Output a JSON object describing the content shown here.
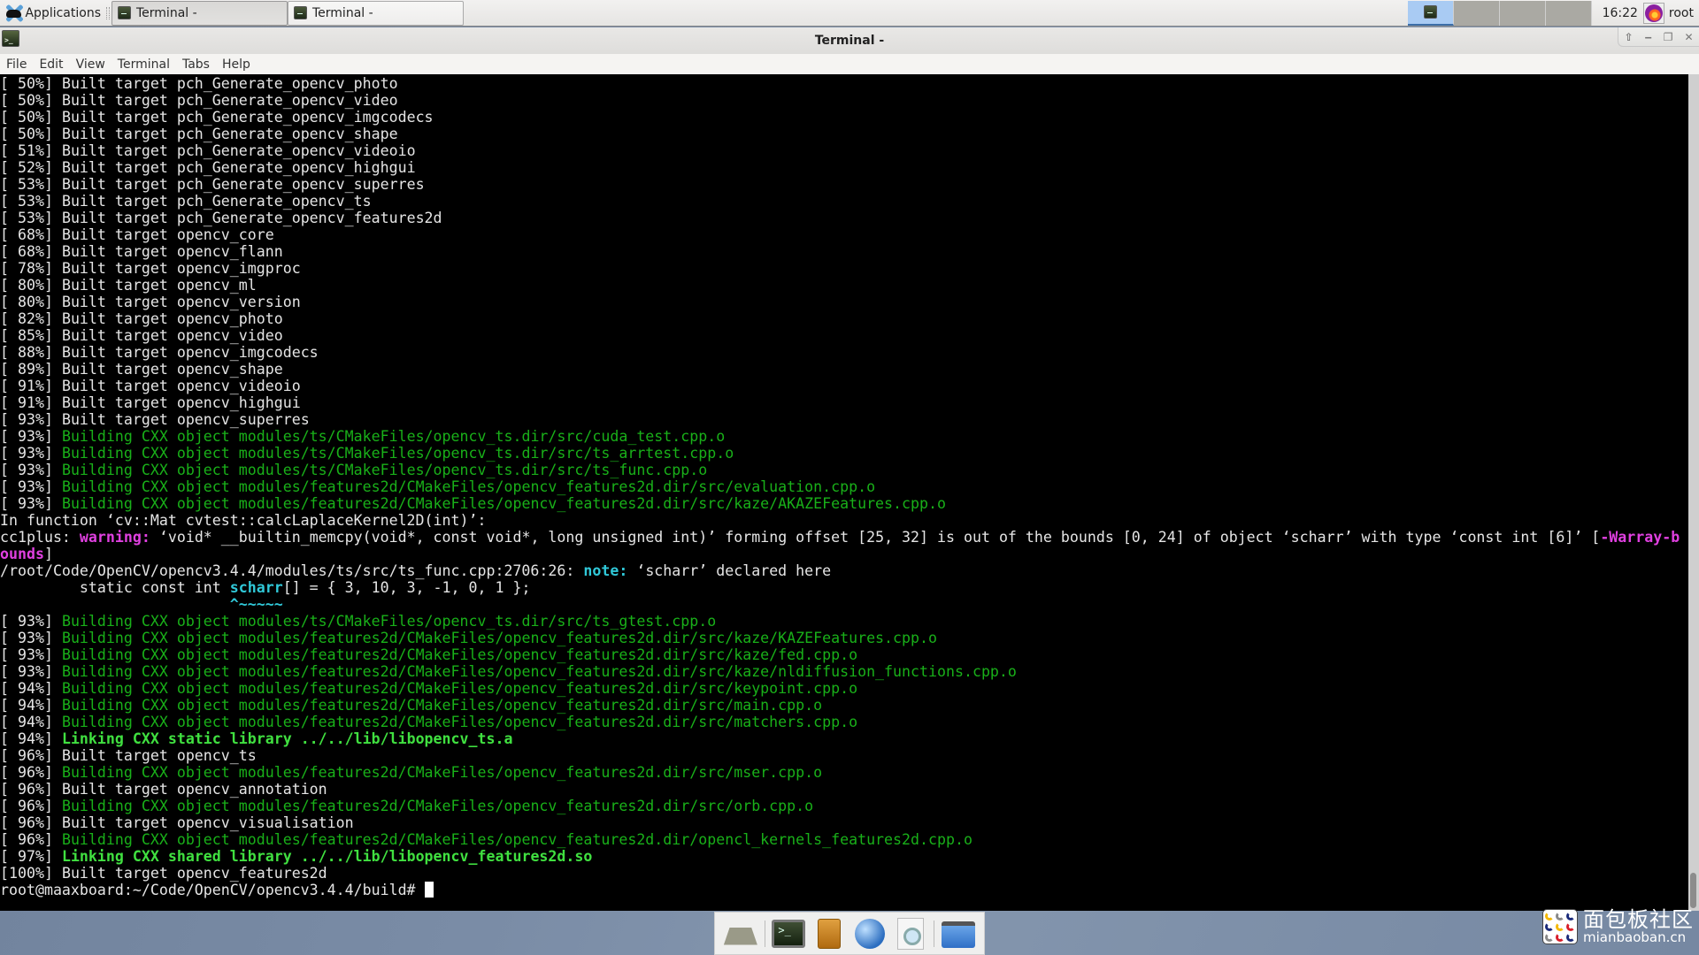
{
  "top_panel": {
    "applications_label": "Applications",
    "tasks": [
      {
        "label": "Terminal -",
        "active": true
      },
      {
        "label": "Terminal -",
        "active": false
      }
    ],
    "clock": "16:22",
    "user": "root"
  },
  "window": {
    "title": "Terminal -",
    "controls": {
      "shade": "⇧",
      "minimize": "‒",
      "maximize": "❐",
      "close": "✕"
    },
    "menu": [
      "File",
      "Edit",
      "View",
      "Terminal",
      "Tabs",
      "Help"
    ]
  },
  "terminal": {
    "lines": [
      {
        "type": "built",
        "pct": "[ 50%]",
        "text": "Built target pch_Generate_opencv_photo"
      },
      {
        "type": "built",
        "pct": "[ 50%]",
        "text": "Built target pch_Generate_opencv_video"
      },
      {
        "type": "built",
        "pct": "[ 50%]",
        "text": "Built target pch_Generate_opencv_imgcodecs"
      },
      {
        "type": "built",
        "pct": "[ 50%]",
        "text": "Built target pch_Generate_opencv_shape"
      },
      {
        "type": "built",
        "pct": "[ 51%]",
        "text": "Built target pch_Generate_opencv_videoio"
      },
      {
        "type": "built",
        "pct": "[ 52%]",
        "text": "Built target pch_Generate_opencv_highgui"
      },
      {
        "type": "built",
        "pct": "[ 53%]",
        "text": "Built target pch_Generate_opencv_superres"
      },
      {
        "type": "built",
        "pct": "[ 53%]",
        "text": "Built target pch_Generate_opencv_ts"
      },
      {
        "type": "built",
        "pct": "[ 53%]",
        "text": "Built target pch_Generate_opencv_features2d"
      },
      {
        "type": "built",
        "pct": "[ 68%]",
        "text": "Built target opencv_core"
      },
      {
        "type": "built",
        "pct": "[ 68%]",
        "text": "Built target opencv_flann"
      },
      {
        "type": "built",
        "pct": "[ 78%]",
        "text": "Built target opencv_imgproc"
      },
      {
        "type": "built",
        "pct": "[ 80%]",
        "text": "Built target opencv_ml"
      },
      {
        "type": "built",
        "pct": "[ 80%]",
        "text": "Built target opencv_version"
      },
      {
        "type": "built",
        "pct": "[ 82%]",
        "text": "Built target opencv_photo"
      },
      {
        "type": "built",
        "pct": "[ 85%]",
        "text": "Built target opencv_video"
      },
      {
        "type": "built",
        "pct": "[ 88%]",
        "text": "Built target opencv_imgcodecs"
      },
      {
        "type": "built",
        "pct": "[ 89%]",
        "text": "Built target opencv_shape"
      },
      {
        "type": "built",
        "pct": "[ 91%]",
        "text": "Built target opencv_videoio"
      },
      {
        "type": "built",
        "pct": "[ 91%]",
        "text": "Built target opencv_highgui"
      },
      {
        "type": "built",
        "pct": "[ 93%]",
        "text": "Built target opencv_superres"
      },
      {
        "type": "building",
        "pct": "[ 93%]",
        "text": "Building CXX object modules/ts/CMakeFiles/opencv_ts.dir/src/cuda_test.cpp.o"
      },
      {
        "type": "building",
        "pct": "[ 93%]",
        "text": "Building CXX object modules/ts/CMakeFiles/opencv_ts.dir/src/ts_arrtest.cpp.o"
      },
      {
        "type": "building",
        "pct": "[ 93%]",
        "text": "Building CXX object modules/ts/CMakeFiles/opencv_ts.dir/src/ts_func.cpp.o"
      },
      {
        "type": "building",
        "pct": "[ 93%]",
        "text": "Building CXX object modules/features2d/CMakeFiles/opencv_features2d.dir/src/evaluation.cpp.o"
      },
      {
        "type": "building",
        "pct": "[ 93%]",
        "text": "Building CXX object modules/features2d/CMakeFiles/opencv_features2d.dir/src/kaze/AKAZEFeatures.cpp.o"
      },
      {
        "type": "rich",
        "segments": [
          {
            "s": "plain",
            "t": "In function ‘"
          },
          {
            "s": "bold",
            "t": "cv::Mat cvtest::calcLaplaceKernel2D(int)"
          },
          {
            "s": "plain",
            "t": "’:"
          }
        ]
      },
      {
        "type": "rich",
        "segments": [
          {
            "s": "bold",
            "t": "cc1plus: "
          },
          {
            "s": "mag",
            "t": "warning: "
          },
          {
            "s": "plain",
            "t": "‘"
          },
          {
            "s": "bold",
            "t": "void* __builtin_memcpy(void*, const void*, long unsigned int)"
          },
          {
            "s": "plain",
            "t": "’ forming offset [25, 32] is out of the bounds [0, 24] of object ‘"
          },
          {
            "s": "bold",
            "t": "scharr"
          },
          {
            "s": "plain",
            "t": "’ with type ‘"
          },
          {
            "s": "bold",
            "t": "const int [6]"
          },
          {
            "s": "plain",
            "t": "’ ["
          },
          {
            "s": "mag",
            "t": "-Warray-b"
          }
        ]
      },
      {
        "type": "rich",
        "segments": [
          {
            "s": "mag",
            "t": "ounds"
          },
          {
            "s": "plain",
            "t": "]"
          }
        ]
      },
      {
        "type": "rich",
        "segments": [
          {
            "s": "bold",
            "t": "/root/Code/OpenCV/opencv3.4.4/modules/ts/src/ts_func.cpp:2706:26: "
          },
          {
            "s": "cy",
            "t": "note: "
          },
          {
            "s": "plain",
            "t": "‘"
          },
          {
            "s": "bold",
            "t": "scharr"
          },
          {
            "s": "plain",
            "t": "’ declared here"
          }
        ]
      },
      {
        "type": "rich",
        "segments": [
          {
            "s": "plain",
            "t": "         static const int "
          },
          {
            "s": "cy",
            "t": "scharr"
          },
          {
            "s": "plain",
            "t": "[] = { 3, 10, 3, -1, 0, 1 };"
          }
        ]
      },
      {
        "type": "rich",
        "segments": [
          {
            "s": "plain",
            "t": "                          "
          },
          {
            "s": "cy",
            "t": "^~~~~~"
          }
        ]
      },
      {
        "type": "building",
        "pct": "[ 93%]",
        "text": "Building CXX object modules/ts/CMakeFiles/opencv_ts.dir/src/ts_gtest.cpp.o"
      },
      {
        "type": "building",
        "pct": "[ 93%]",
        "text": "Building CXX object modules/features2d/CMakeFiles/opencv_features2d.dir/src/kaze/KAZEFeatures.cpp.o"
      },
      {
        "type": "building",
        "pct": "[ 93%]",
        "text": "Building CXX object modules/features2d/CMakeFiles/opencv_features2d.dir/src/kaze/fed.cpp.o"
      },
      {
        "type": "building",
        "pct": "[ 93%]",
        "text": "Building CXX object modules/features2d/CMakeFiles/opencv_features2d.dir/src/kaze/nldiffusion_functions.cpp.o"
      },
      {
        "type": "building",
        "pct": "[ 94%]",
        "text": "Building CXX object modules/features2d/CMakeFiles/opencv_features2d.dir/src/keypoint.cpp.o"
      },
      {
        "type": "building",
        "pct": "[ 94%]",
        "text": "Building CXX object modules/features2d/CMakeFiles/opencv_features2d.dir/src/main.cpp.o"
      },
      {
        "type": "building",
        "pct": "[ 94%]",
        "text": "Building CXX object modules/features2d/CMakeFiles/opencv_features2d.dir/src/matchers.cpp.o"
      },
      {
        "type": "linking",
        "pct": "[ 94%]",
        "text": "Linking CXX static library ../../lib/libopencv_ts.a"
      },
      {
        "type": "built",
        "pct": "[ 96%]",
        "text": "Built target opencv_ts"
      },
      {
        "type": "building",
        "pct": "[ 96%]",
        "text": "Building CXX object modules/features2d/CMakeFiles/opencv_features2d.dir/src/mser.cpp.o"
      },
      {
        "type": "built",
        "pct": "[ 96%]",
        "text": "Built target opencv_annotation"
      },
      {
        "type": "building",
        "pct": "[ 96%]",
        "text": "Building CXX object modules/features2d/CMakeFiles/opencv_features2d.dir/src/orb.cpp.o"
      },
      {
        "type": "built",
        "pct": "[ 96%]",
        "text": "Built target opencv_visualisation"
      },
      {
        "type": "building",
        "pct": "[ 96%]",
        "text": "Building CXX object modules/features2d/CMakeFiles/opencv_features2d.dir/opencl_kernels_features2d.cpp.o"
      },
      {
        "type": "linking",
        "pct": "[ 97%]",
        "text": "Linking CXX shared library ../../lib/libopencv_features2d.so"
      },
      {
        "type": "built",
        "pct": "[100%]",
        "text": "Built target opencv_features2d"
      }
    ],
    "prompt": "root@maaxboard:~/Code/OpenCV/opencv3.4.4/build# "
  },
  "dock": {
    "items": [
      {
        "name": "show-desktop",
        "icon": "desktop-icon"
      },
      {
        "name": "terminal",
        "icon": "terminal-icon"
      },
      {
        "name": "file-manager",
        "icon": "file-cabinet-icon"
      },
      {
        "name": "web-browser",
        "icon": "globe-icon"
      },
      {
        "name": "app-finder",
        "icon": "search-document-icon"
      },
      {
        "name": "folder",
        "icon": "folder-icon"
      }
    ]
  },
  "watermark": {
    "chinese_text": "面包板社区",
    "url": "mianbaoban.cn"
  },
  "colors": {
    "terminal_bg": "#000000",
    "building_green": "#19b019",
    "linking_green": "#40e040",
    "warning_magenta": "#e040e0",
    "note_cyan": "#30c8d8"
  }
}
